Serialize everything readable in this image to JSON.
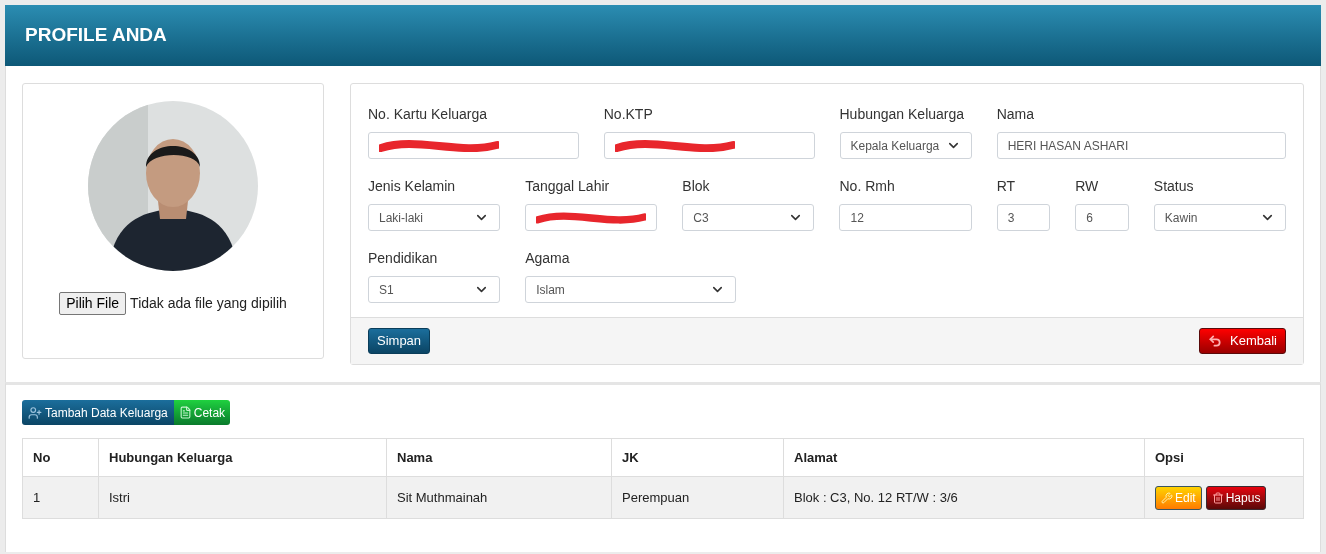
{
  "header": {
    "title": "PROFILE ANDA"
  },
  "file_input": {
    "button": "Pilih File",
    "status": "Tidak ada file yang dipilih"
  },
  "form": {
    "fields": [
      {
        "label": "No. Kartu Keluarga",
        "kind": "redacted"
      },
      {
        "label": "No.KTP",
        "kind": "redacted"
      },
      {
        "label": "Hubungan Keluarga",
        "kind": "select",
        "value": "Kepala Keluarga"
      },
      {
        "label": "Nama",
        "kind": "text",
        "value": "HERI HASAN ASHARI"
      },
      {
        "label": "Jenis Kelamin",
        "kind": "select",
        "value": "Laki-laki"
      },
      {
        "label": "Tanggal Lahir",
        "kind": "redacted"
      },
      {
        "label": "Blok",
        "kind": "select",
        "value": "C3"
      },
      {
        "label": "No. Rmh",
        "kind": "text",
        "value": "12"
      },
      {
        "label": "RT",
        "kind": "text",
        "value": "3"
      },
      {
        "label": "RW",
        "kind": "text",
        "value": "6"
      },
      {
        "label": "Status",
        "kind": "select",
        "value": "Kawin"
      },
      {
        "label": "Pendidikan",
        "kind": "select",
        "value": "S1"
      },
      {
        "label": "Agama",
        "kind": "select",
        "value": "Islam"
      }
    ],
    "save_button": "Simpan",
    "back_button": "Kembali"
  },
  "toolbar": {
    "add_button": "Tambah Data Keluarga",
    "print_button": "Cetak"
  },
  "table": {
    "columns": [
      "No",
      "Hubungan Keluarga",
      "Nama",
      "JK",
      "Alamat",
      "Opsi"
    ],
    "rows": [
      {
        "cells": [
          "1",
          "Istri",
          "Sit Muthmainah",
          "Perempuan",
          "Blok : C3, No. 12 RT/W : 3/6"
        ],
        "edit": "Edit",
        "delete": "Hapus"
      }
    ]
  }
}
